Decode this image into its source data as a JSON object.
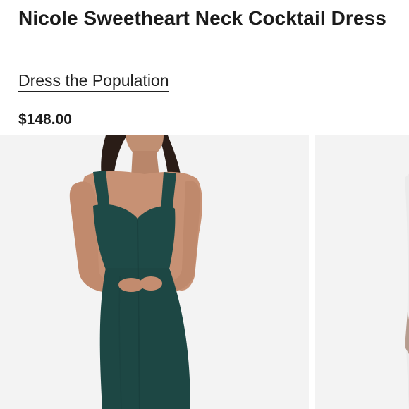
{
  "product": {
    "title": "Nicole Sweetheart Neck Cocktail Dress",
    "brand": "Dress the Population",
    "price": "$148.00"
  },
  "gallery": {
    "images": [
      {
        "alt": "Model wearing green sweetheart neck midi dress"
      },
      {
        "alt": "Second product view"
      }
    ]
  },
  "colors": {
    "dress": "#1e4a47",
    "background": "#f2f2f2",
    "text": "#1b1b1b"
  }
}
